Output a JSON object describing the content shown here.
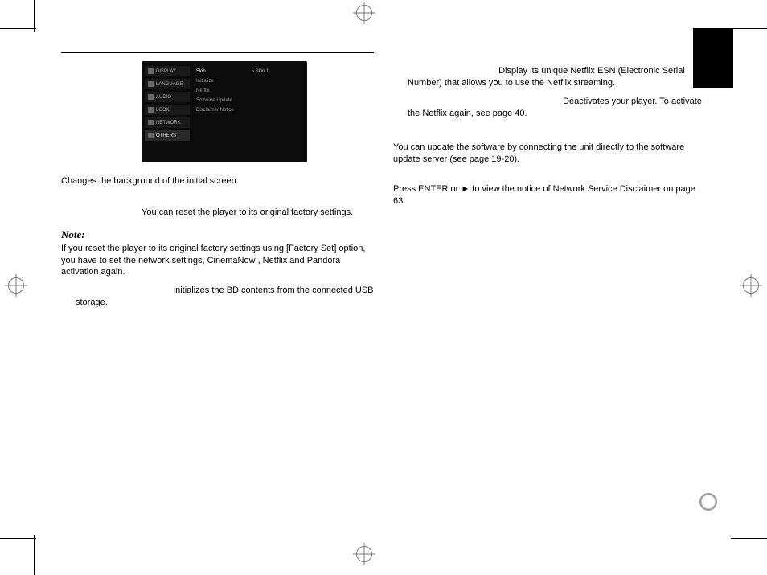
{
  "screenshot": {
    "menu": [
      {
        "label": "DISPLAY"
      },
      {
        "label": "LANGUAGE"
      },
      {
        "label": "AUDIO"
      },
      {
        "label": "LOCK"
      },
      {
        "label": "NETWORK"
      },
      {
        "label": "OTHERS"
      }
    ],
    "submenu": [
      "Skin",
      "Initialize",
      "Netflix",
      "Software Update",
      "Disclaimer Notice"
    ],
    "value": "Skin 1"
  },
  "left": {
    "skin_desc": "Changes the background of the initial screen.",
    "factory_reset": "You can reset the player to its original factory settings.",
    "note_heading": "Note:",
    "note_text": "If you reset the player to its original factory settings using [Factory Set] option, you have to set the network settings, CinemaNow , Netflix and Pandora activation again.",
    "bd_init": "Initializes the BD contents from the connected USB storage."
  },
  "right": {
    "esn": "Display its unique Netflix ESN (Electronic Serial Number) that allows you to use the Netflix streaming.",
    "deactivate": "Deactivates your player. To activate the Netflix again, see page 40.",
    "update": "You can update the software by connecting the unit directly to the software update server (see page 19-20).",
    "disclaimer": "Press ENTER or ► to view the notice of Network Service Disclaimer on page 63."
  }
}
